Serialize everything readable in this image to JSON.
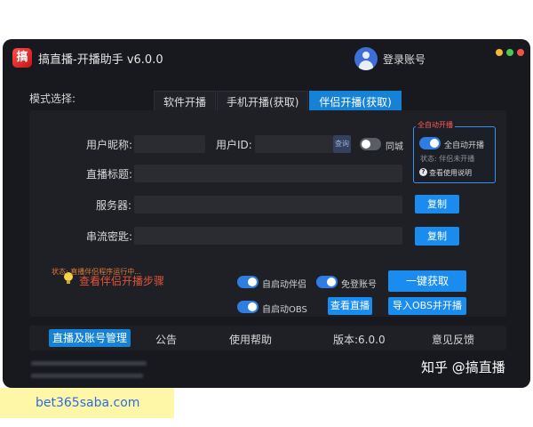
{
  "window": {
    "title": "搞直播-开播助手 v6.0.0",
    "app_icon_text": "搞",
    "login_label": "登录账号"
  },
  "mode": {
    "label": "模式选择:",
    "tabs": [
      "软件开播",
      "手机开播(获取)",
      "伴侣开播(获取)"
    ],
    "active_tab_index": 2
  },
  "form": {
    "nickname_label": "用户昵称:",
    "nickname_value": "",
    "user_id_label": "用户ID:",
    "user_id_value": "",
    "search_button": "查询",
    "same_city_label": "同城",
    "same_city_on": false,
    "title_label": "直播标题:",
    "title_value": "",
    "server_label": "服务器:",
    "server_value": "",
    "stream_key_label": "串流密匙:",
    "stream_key_value": "",
    "copy_button": "复制"
  },
  "auto_start": {
    "title": "全自动开播",
    "toggle_label": "全自动开播",
    "toggle_on": true,
    "status": "状态: 伴侣未开播",
    "help_link": "查看使用说明"
  },
  "actions": {
    "steps_link": "查看伴侣开播步骤",
    "auto_start_companion": "自启动伴侣",
    "auto_start_companion_on": true,
    "login_free": "免登账号",
    "login_free_on": true,
    "one_click_button": "一键获取",
    "auto_start_obs": "自启动OBS",
    "auto_start_obs_on": true,
    "view_live_button": "查看直播",
    "import_obs_button": "导入OBS并开播",
    "status_message": "状态: 直播伴侣程序运行中..."
  },
  "bottom_nav": {
    "items": [
      "直播及账号管理",
      "公告",
      "使用帮助",
      "版本:6.0.0",
      "意见反馈"
    ],
    "active_index": 0
  },
  "watermark": "知乎 @搞直播",
  "url_banner": "bet365saba.com",
  "colors": {
    "accent": "#1682d6",
    "window_bg": "#17191e",
    "panel_bg": "#1e2025",
    "warning_text": "#e0543a"
  }
}
